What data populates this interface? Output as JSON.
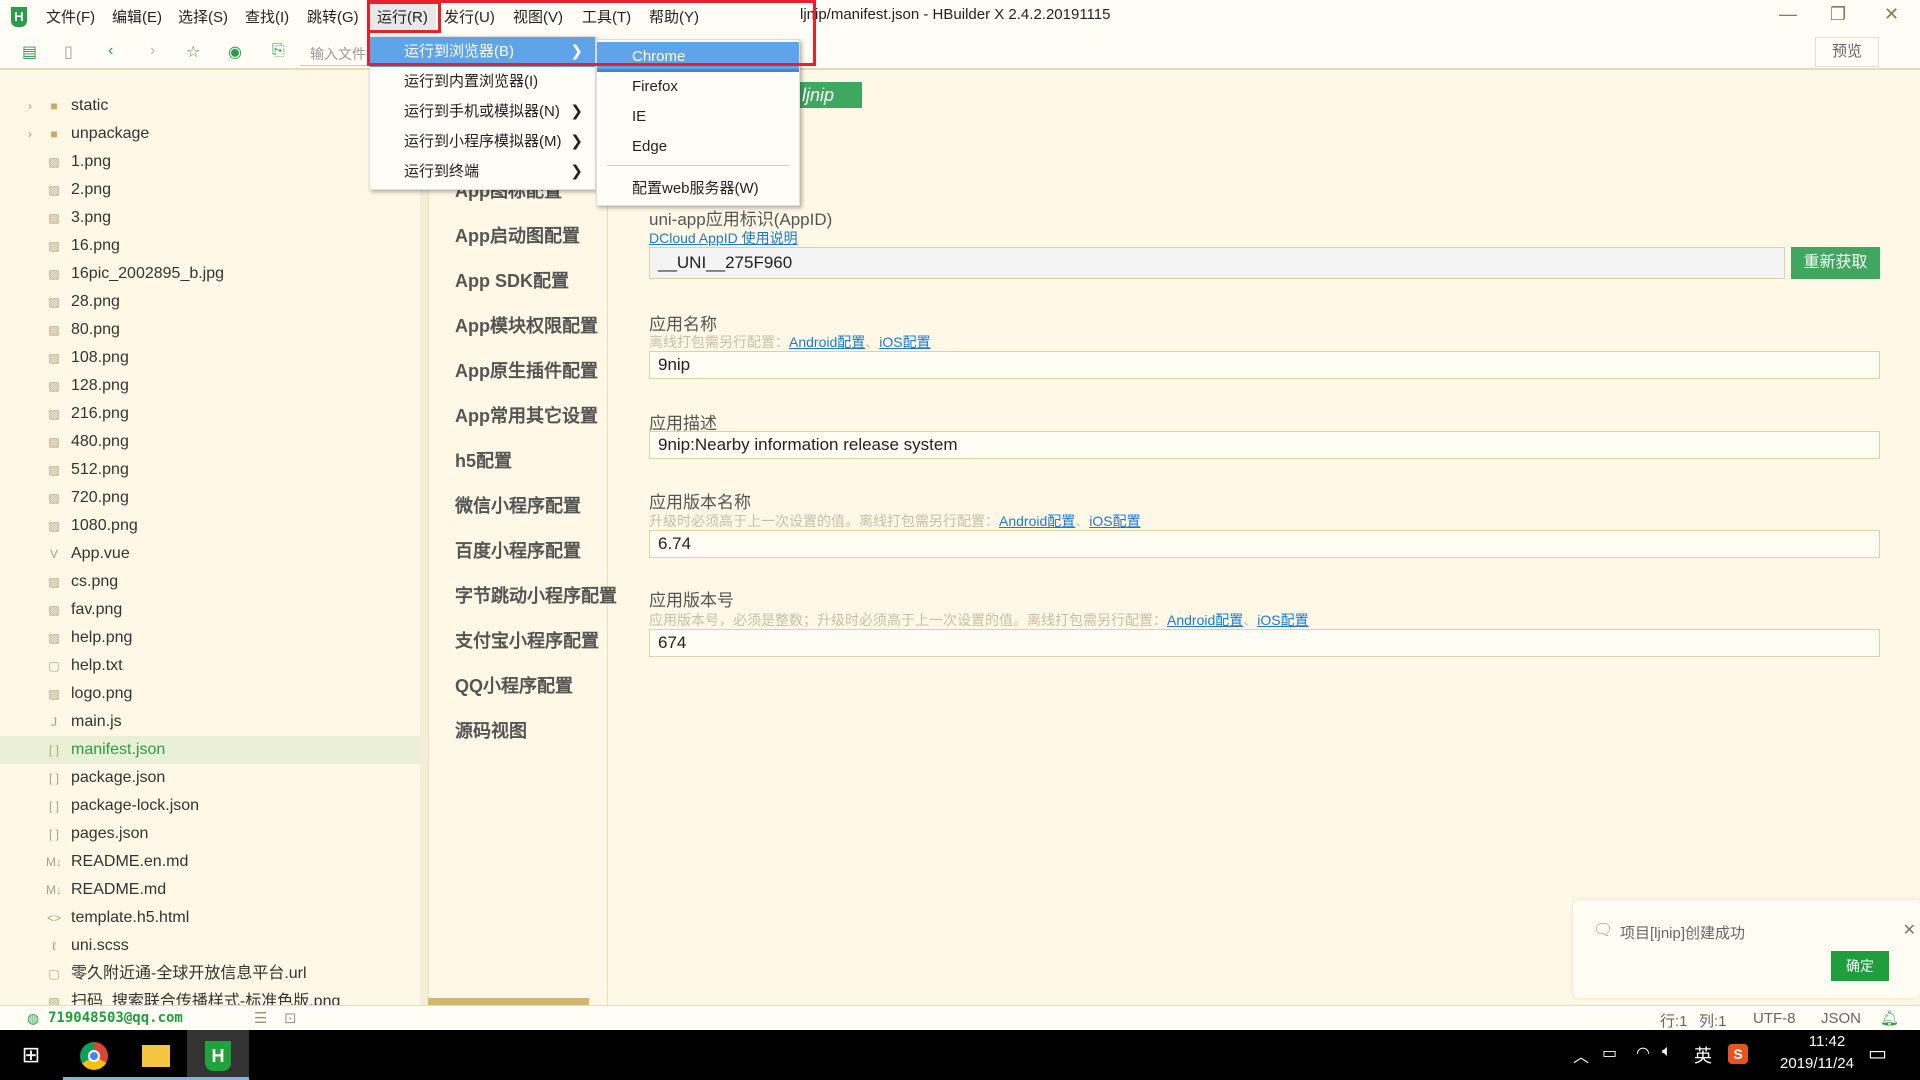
{
  "app": {
    "title": "ljnip/manifest.json - HBuilder X 2.4.2.20191115",
    "logo": "H"
  },
  "menu": [
    "文件(F)",
    "编辑(E)",
    "选择(S)",
    "查找(I)",
    "跳转(G)",
    "运行(R)",
    "发行(U)",
    "视图(V)",
    "工具(T)",
    "帮助(Y)"
  ],
  "toolbar": {
    "search_placeholder": "输入文件",
    "preview": "预览"
  },
  "files": [
    {
      "name": "static",
      "type": "folder"
    },
    {
      "name": "unpackage",
      "type": "folder"
    },
    {
      "name": "1.png",
      "type": "image"
    },
    {
      "name": "2.png",
      "type": "image"
    },
    {
      "name": "3.png",
      "type": "image"
    },
    {
      "name": "16.png",
      "type": "image"
    },
    {
      "name": "16pic_2002895_b.jpg",
      "type": "image"
    },
    {
      "name": "28.png",
      "type": "image"
    },
    {
      "name": "80.png",
      "type": "image"
    },
    {
      "name": "108.png",
      "type": "image"
    },
    {
      "name": "128.png",
      "type": "image"
    },
    {
      "name": "216.png",
      "type": "image"
    },
    {
      "name": "480.png",
      "type": "image"
    },
    {
      "name": "512.png",
      "type": "image"
    },
    {
      "name": "720.png",
      "type": "image"
    },
    {
      "name": "1080.png",
      "type": "image"
    },
    {
      "name": "App.vue",
      "type": "vue"
    },
    {
      "name": "cs.png",
      "type": "image"
    },
    {
      "name": "fav.png",
      "type": "image"
    },
    {
      "name": "help.png",
      "type": "image"
    },
    {
      "name": "help.txt",
      "type": "file"
    },
    {
      "name": "logo.png",
      "type": "image"
    },
    {
      "name": "main.js",
      "type": "js"
    },
    {
      "name": "manifest.json",
      "type": "json",
      "selected": true
    },
    {
      "name": "package.json",
      "type": "json"
    },
    {
      "name": "package-lock.json",
      "type": "json"
    },
    {
      "name": "pages.json",
      "type": "json"
    },
    {
      "name": "README.en.md",
      "type": "md"
    },
    {
      "name": "README.md",
      "type": "md"
    },
    {
      "name": "template.h5.html",
      "type": "html"
    },
    {
      "name": "uni.scss",
      "type": "scss"
    },
    {
      "name": "零久附近通-全球开放信息平台.url",
      "type": "file"
    },
    {
      "name": "扫码_搜索联合传播样式-标准色版.png",
      "type": "image"
    }
  ],
  "nav": [
    "App图标配置",
    "App启动图配置",
    "App SDK配置",
    "App模块权限配置",
    "App原生插件配置",
    "App常用其它设置",
    "h5配置",
    "微信小程序配置",
    "百度小程序配置",
    "字节跳动小程序配置",
    "支付宝小程序配置",
    "QQ小程序配置",
    "源码视图"
  ],
  "badge": "ljnip",
  "form": {
    "appid": {
      "label": "uni-app应用标识(AppID)",
      "link": "DCloud AppID 使用说明",
      "value": "__UNI__275F960",
      "button": "重新获取"
    },
    "name": {
      "label": "应用名称",
      "hint": "离线打包需另行配置：",
      "android": "Android配置",
      "sep": "、",
      "ios": "iOS配置",
      "value": "9nip"
    },
    "desc": {
      "label": "应用描述",
      "value": "9nip:Nearby information release system"
    },
    "version_name": {
      "label": "应用版本名称",
      "hint": "升级时必须高于上一次设置的值。离线打包需另行配置：",
      "android": "Android配置",
      "sep": "、",
      "ios": "iOS配置",
      "value": "6.74"
    },
    "version_code": {
      "label": "应用版本号",
      "hint": "应用版本号，必须是整数；升级时必须高于上一次设置的值。离线打包需另行配置：",
      "android": "Android配置",
      "sep": "、",
      "ios": "iOS配置",
      "value": "674"
    }
  },
  "run_menu": {
    "items": [
      {
        "label": "运行到浏览器(B)",
        "arrow": true
      },
      {
        "label": "运行到内置浏览器(I)",
        "arrow": false
      },
      {
        "label": "运行到手机或模拟器(N)",
        "arrow": true
      },
      {
        "label": "运行到小程序模拟器(M)",
        "arrow": true
      },
      {
        "label": "运行到终端",
        "arrow": true
      }
    ]
  },
  "browser_menu": {
    "items": [
      "Chrome",
      "Firefox",
      "IE",
      "Edge"
    ],
    "config": "配置web服务器(W)"
  },
  "toast": {
    "message": "项目[ljnip]创建成功",
    "ok": "确定"
  },
  "status": {
    "user": "719048503@qq.com",
    "line": "行:1",
    "col": "列:1",
    "encoding": "UTF-8",
    "syntax": "JSON"
  },
  "taskbar": {
    "ime": "英",
    "time": "11:42",
    "date": "2019/11/24"
  },
  "colors": {
    "accent": "#2a9d4a",
    "menu_highlight": "#5fa3e8",
    "annotation": "#e8202a",
    "background": "#fff8e6"
  }
}
